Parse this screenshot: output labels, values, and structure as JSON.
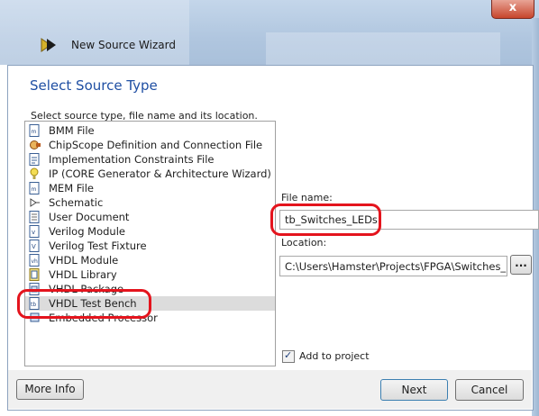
{
  "window": {
    "title": "New Source Wizard",
    "close_glyph": "x"
  },
  "page": {
    "heading": "Select Source Type",
    "subtitle": "Select source type, file name and its location."
  },
  "source_types": [
    {
      "label": "BMM File",
      "icon": "vhdl-file-icon"
    },
    {
      "label": "ChipScope Definition and Connection File",
      "icon": "chipscope-icon"
    },
    {
      "label": "Implementation Constraints File",
      "icon": "constraints-file-icon"
    },
    {
      "label": "IP (CORE Generator & Architecture Wizard)",
      "icon": "ip-core-icon"
    },
    {
      "label": "MEM File",
      "icon": "vhdl-file-icon"
    },
    {
      "label": "Schematic",
      "icon": "schematic-icon"
    },
    {
      "label": "User Document",
      "icon": "document-icon"
    },
    {
      "label": "Verilog Module",
      "icon": "verilog-module-icon"
    },
    {
      "label": "Verilog Test Fixture",
      "icon": "verilog-test-icon"
    },
    {
      "label": "VHDL Module",
      "icon": "vhdl-module-icon"
    },
    {
      "label": "VHDL Library",
      "icon": "vhdl-library-icon"
    },
    {
      "label": "VHDL Package",
      "icon": "vhdl-package-icon"
    },
    {
      "label": "VHDL Test Bench",
      "icon": "vhdl-testbench-icon"
    },
    {
      "label": "Embedded Processor",
      "icon": "processor-icon"
    }
  ],
  "selected_source_type": "VHDL Test Bench",
  "form": {
    "file_name_label": "File name:",
    "file_name_value": "tb_Switches_LEDs",
    "location_label": "Location:",
    "location_value": "C:\\Users\\Hamster\\Projects\\FPGA\\Switches_LEDs",
    "browse_label": "...",
    "add_to_project_label": "Add to project",
    "add_to_project_checked": true,
    "check_glyph": "✓"
  },
  "buttons": {
    "more_info": "More Info",
    "next": "Next",
    "cancel": "Cancel"
  },
  "colors": {
    "heading": "#1f4fa3",
    "annotation": "#e4141d",
    "selection": "#dcdcdc"
  }
}
